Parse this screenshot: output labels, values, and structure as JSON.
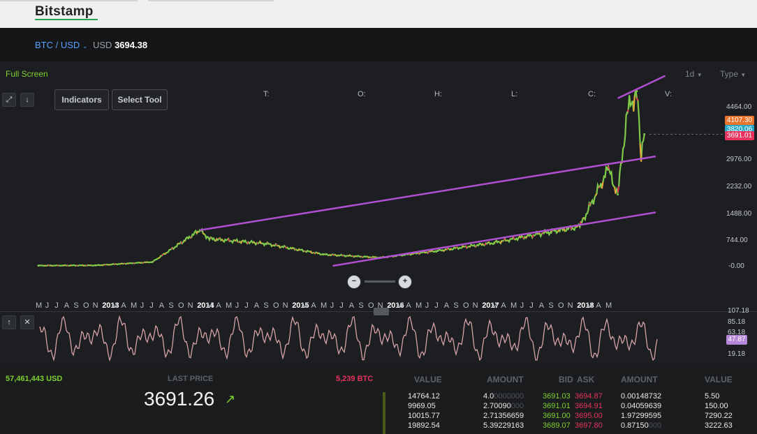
{
  "header": {
    "brand": "Bitstamp"
  },
  "market": {
    "pair": "BTC / USD",
    "pair_chevron": "chevron-down-icon",
    "currency": "USD",
    "price": "3694.38"
  },
  "toolbar": {
    "fullscreen_label": "Full Screen",
    "period_label": "1d",
    "type_label": "Type",
    "indicators_label": "Indicators",
    "select_tool_label": "Select Tool",
    "ohlc": {
      "t": "T:",
      "o": "O:",
      "h": "H:",
      "l": "L:",
      "c": "C:",
      "v": "V:"
    }
  },
  "price_axis": {
    "ticks": [
      "4464.00",
      "2976.00",
      "2232.00",
      "1488.00",
      "744.00",
      "-0.00"
    ],
    "tags": [
      {
        "value": "4107.30",
        "color": "#e8742c"
      },
      {
        "value": "3820.06",
        "color": "#2aa9c9"
      },
      {
        "value": "3691.01",
        "color": "#e8335d"
      }
    ]
  },
  "time_axis": {
    "labels": [
      "M",
      "J",
      "J",
      "A",
      "S",
      "O",
      "N",
      "2013",
      "M",
      "A",
      "M",
      "J",
      "J",
      "A",
      "S",
      "O",
      "N",
      "2014",
      "M",
      "A",
      "M",
      "J",
      "J",
      "A",
      "S",
      "O",
      "N",
      "2015",
      "M",
      "A",
      "M",
      "J",
      "J",
      "A",
      "S",
      "O",
      "N",
      "2016",
      "M",
      "A",
      "M",
      "J",
      "J",
      "A",
      "S",
      "O",
      "N",
      "2017",
      "M",
      "A",
      "M",
      "J",
      "J",
      "A",
      "S",
      "O",
      "N",
      "2018",
      "M",
      "A",
      "M"
    ]
  },
  "oscillator": {
    "ticks": [
      "107.18",
      "85.18",
      "63.18",
      "19.18"
    ],
    "current": "47.87",
    "current_color": "#b487d8"
  },
  "stats": {
    "volume_usd": "57,461,443 USD",
    "last_price_label": "LAST PRICE",
    "last_price": "3691.26",
    "trend_icon": "arrow-up-right-icon",
    "volume_btc": "5,239 BTC"
  },
  "orderbook": {
    "headers": [
      "VALUE",
      "AMOUNT",
      "BID",
      "ASK",
      "AMOUNT",
      "VALUE"
    ],
    "rows": [
      {
        "bid_value": "14764.12",
        "bid_amount": "4.0",
        "bid_amount_dim": "0000000",
        "bid": "3691.03",
        "ask": "3694.87",
        "ask_amount": "0.00148732",
        "ask_value": "5.50"
      },
      {
        "bid_value": "9969.05",
        "bid_amount": "2.70090",
        "bid_amount_dim": "000",
        "bid": "3691.01",
        "ask": "3694.91",
        "ask_amount": "0.04059639",
        "ask_value": "150.00"
      },
      {
        "bid_value": "10015.77",
        "bid_amount": "2.71356659",
        "bid_amount_dim": "",
        "bid": "3691.00",
        "ask": "3695.00",
        "ask_amount": "1.97299595",
        "ask_value": "7290.22"
      },
      {
        "bid_value": "19892.54",
        "bid_amount": "5.39229163",
        "bid_amount_dim": "",
        "bid": "3689.07",
        "ask": "3697.80",
        "ask_amount": "0.87150",
        "ask_amount_dim": "000",
        "ask_value": "3222.63"
      }
    ]
  },
  "chart_data": {
    "type": "line",
    "title": "",
    "xlabel": "",
    "ylabel": "",
    "ylim": [
      0,
      4900
    ],
    "x": [
      "2012-06",
      "2012-12",
      "2013-06",
      "2013-11",
      "2013-12",
      "2014-06",
      "2014-12",
      "2015-06",
      "2015-12",
      "2016-06",
      "2016-12",
      "2017-03",
      "2017-06",
      "2017-07",
      "2017-08",
      "2017-09-01",
      "2017-09-15",
      "2017-09-25"
    ],
    "series": [
      {
        "values": [
          6,
          13,
          108,
          1000,
          760,
          620,
          320,
          230,
          420,
          650,
          960,
          1100,
          2700,
          2000,
          4300,
          4900,
          3000,
          3691
        ]
      }
    ],
    "trend_lines": [
      {
        "from": [
          "2013-11",
          1000
        ],
        "to": [
          "2017-11",
          3070
        ]
      },
      {
        "from": [
          "2015-01",
          0
        ],
        "to": [
          "2017-11",
          1500
        ]
      },
      {
        "from": [
          "2017-07",
          4700
        ],
        "to": [
          "2017-12",
          5330
        ]
      }
    ]
  }
}
